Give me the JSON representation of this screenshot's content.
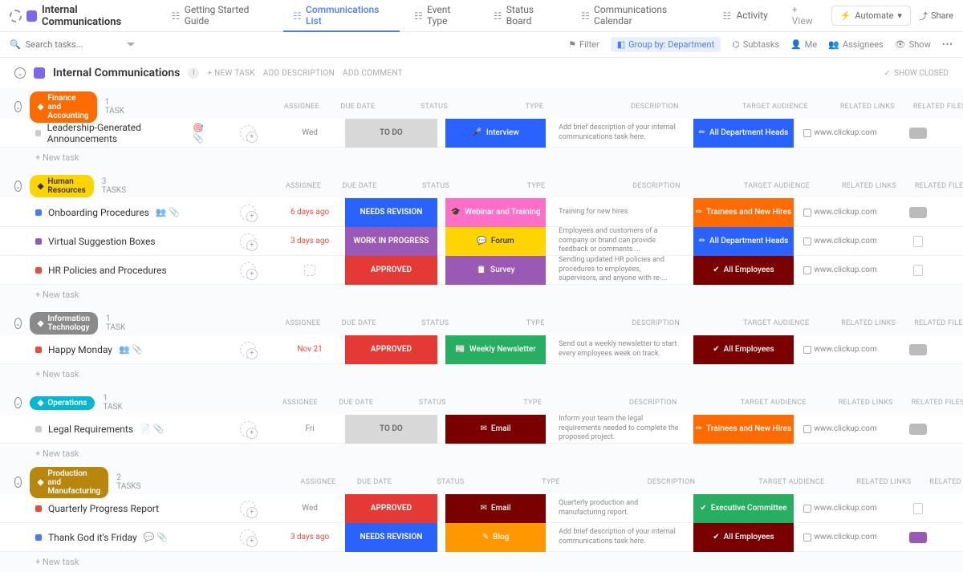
{
  "workspace": "Internal Communications",
  "views": [
    {
      "label": "Getting Started Guide"
    },
    {
      "label": "Communications List",
      "active": true
    },
    {
      "label": "Event Type"
    },
    {
      "label": "Status Board"
    },
    {
      "label": "Communications Calendar"
    },
    {
      "label": "Activity"
    }
  ],
  "addView": "+ View",
  "automate": "Automate",
  "share": "Share",
  "search": {
    "placeholder": "Search tasks..."
  },
  "filters": {
    "filter": "Filter",
    "group": "Group by: Department",
    "subtasks": "Subtasks",
    "me": "Me",
    "assignees": "Assignees",
    "show": "Show"
  },
  "listHeader": {
    "title": "Internal Communications",
    "newTask": "+ NEW TASK",
    "addDesc": "ADD DESCRIPTION",
    "addComment": "ADD COMMENT",
    "showClosed": "SHOW CLOSED"
  },
  "columns": {
    "assignee": "ASSIGNEE",
    "due": "DUE DATE",
    "status": "STATUS",
    "type": "TYPE",
    "desc": "DESCRIPTION",
    "aud": "TARGET AUDIENCE",
    "links": "RELATED LINKS",
    "files": "RELATED FILES"
  },
  "newTask": "+ New task",
  "link": "www.clickup.com",
  "groups": [
    {
      "name": "Finance and Accounting",
      "pill": "orange",
      "count": "1 TASK",
      "rows": [
        {
          "pri": "gray",
          "name": "Leadership-Generated Announcements",
          "extras": "🎯 📎",
          "due": "Wed",
          "status": "TO DO",
          "stCls": "st-todo",
          "type": "Interview",
          "tyCls": "ty-interview",
          "tyIc": "🎤",
          "desc": "Add brief description of your internal communications task here.",
          "aud": "All Department Heads",
          "auCls": "au-heads",
          "auIc": "✏",
          "file": "chip"
        }
      ]
    },
    {
      "name": "Human Resources",
      "pill": "yellow",
      "count": "3 TASKS",
      "rows": [
        {
          "pri": "blue",
          "name": "Onboarding Procedures",
          "extras": "👥 📎",
          "due": "6 days ago",
          "overdue": true,
          "status": "NEEDS REVISION",
          "stCls": "st-needs",
          "type": "Webinar and Training",
          "tyCls": "ty-webinar",
          "tyIc": "🎓",
          "desc": "Training for new hires.",
          "aud": "Trainees and New Hires",
          "auCls": "au-train",
          "auIc": "✏",
          "file": "chip"
        },
        {
          "pri": "purple",
          "name": "Virtual Suggestion Boxes",
          "extras": "",
          "due": "3 days ago",
          "overdue": true,
          "status": "WORK IN PROGRESS",
          "stCls": "st-wip",
          "type": "Forum",
          "tyCls": "ty-forum",
          "tyIc": "💬",
          "desc": "Employees and customers of a company or brand can provide feedback or comments ...",
          "aud": "All Department Heads",
          "auCls": "au-heads",
          "auIc": "✏",
          "file": "doc"
        },
        {
          "pri": "red",
          "name": "HR Policies and Procedures",
          "extras": "",
          "due": "",
          "status": "APPROVED",
          "stCls": "st-approved",
          "type": "Survey",
          "tyCls": "ty-survey",
          "tyIc": "📋",
          "desc": "Sending updated HR policies and procedures to employees, supervisors, and anyone with re-...",
          "aud": "All Employees",
          "auCls": "au-all",
          "auIc": "✔",
          "file": "doc"
        }
      ]
    },
    {
      "name": "Information Technology",
      "pill": "gray",
      "count": "1 TASK",
      "rows": [
        {
          "pri": "red",
          "name": "Happy Monday",
          "extras": "👥 📎",
          "due": "Nov 21",
          "overdue": true,
          "status": "APPROVED",
          "stCls": "st-approved",
          "type": "Weekly Newsletter",
          "tyCls": "ty-news",
          "tyIc": "📰",
          "desc": "Send out a weekly newsletter to start every employees week on track.",
          "aud": "All Employees",
          "auCls": "au-all",
          "auIc": "✔",
          "file": "chip"
        }
      ]
    },
    {
      "name": "Operations",
      "pill": "teal",
      "count": "1 TASK",
      "rows": [
        {
          "pri": "gray",
          "name": "Legal Requirements",
          "extras": "📄 📎",
          "due": "Fri",
          "status": "TO DO",
          "stCls": "st-todo",
          "type": "Email",
          "tyCls": "ty-email",
          "tyIc": "✉",
          "desc": "Inform your team the legal requirements needed to complete the proposed project.",
          "aud": "Trainees and New Hires",
          "auCls": "au-train",
          "auIc": "✏",
          "file": "chip"
        }
      ]
    },
    {
      "name": "Production and Manufacturing",
      "pill": "brown",
      "count": "2 TASKS",
      "rows": [
        {
          "pri": "red",
          "name": "Quarterly Progress Report",
          "extras": "",
          "due": "Wed",
          "status": "APPROVED",
          "stCls": "st-approved",
          "type": "Email",
          "tyCls": "ty-email",
          "tyIc": "✉",
          "desc": "Quarterly production and manufacturing report.",
          "aud": "Executive Committee",
          "auCls": "au-exec",
          "auIc": "✔",
          "file": "doc"
        },
        {
          "pri": "blue",
          "name": "Thank God it's Friday",
          "extras": "💬 📎",
          "due": "3 days ago",
          "overdue": true,
          "status": "NEEDS REVISION",
          "stCls": "st-needs",
          "type": "Blog",
          "tyCls": "ty-blog",
          "tyIc": "✎",
          "desc": "Add brief description of your internal communications task here.",
          "aud": "All Employees",
          "auCls": "au-all",
          "auIc": "✔",
          "file": "purple"
        }
      ]
    }
  ]
}
